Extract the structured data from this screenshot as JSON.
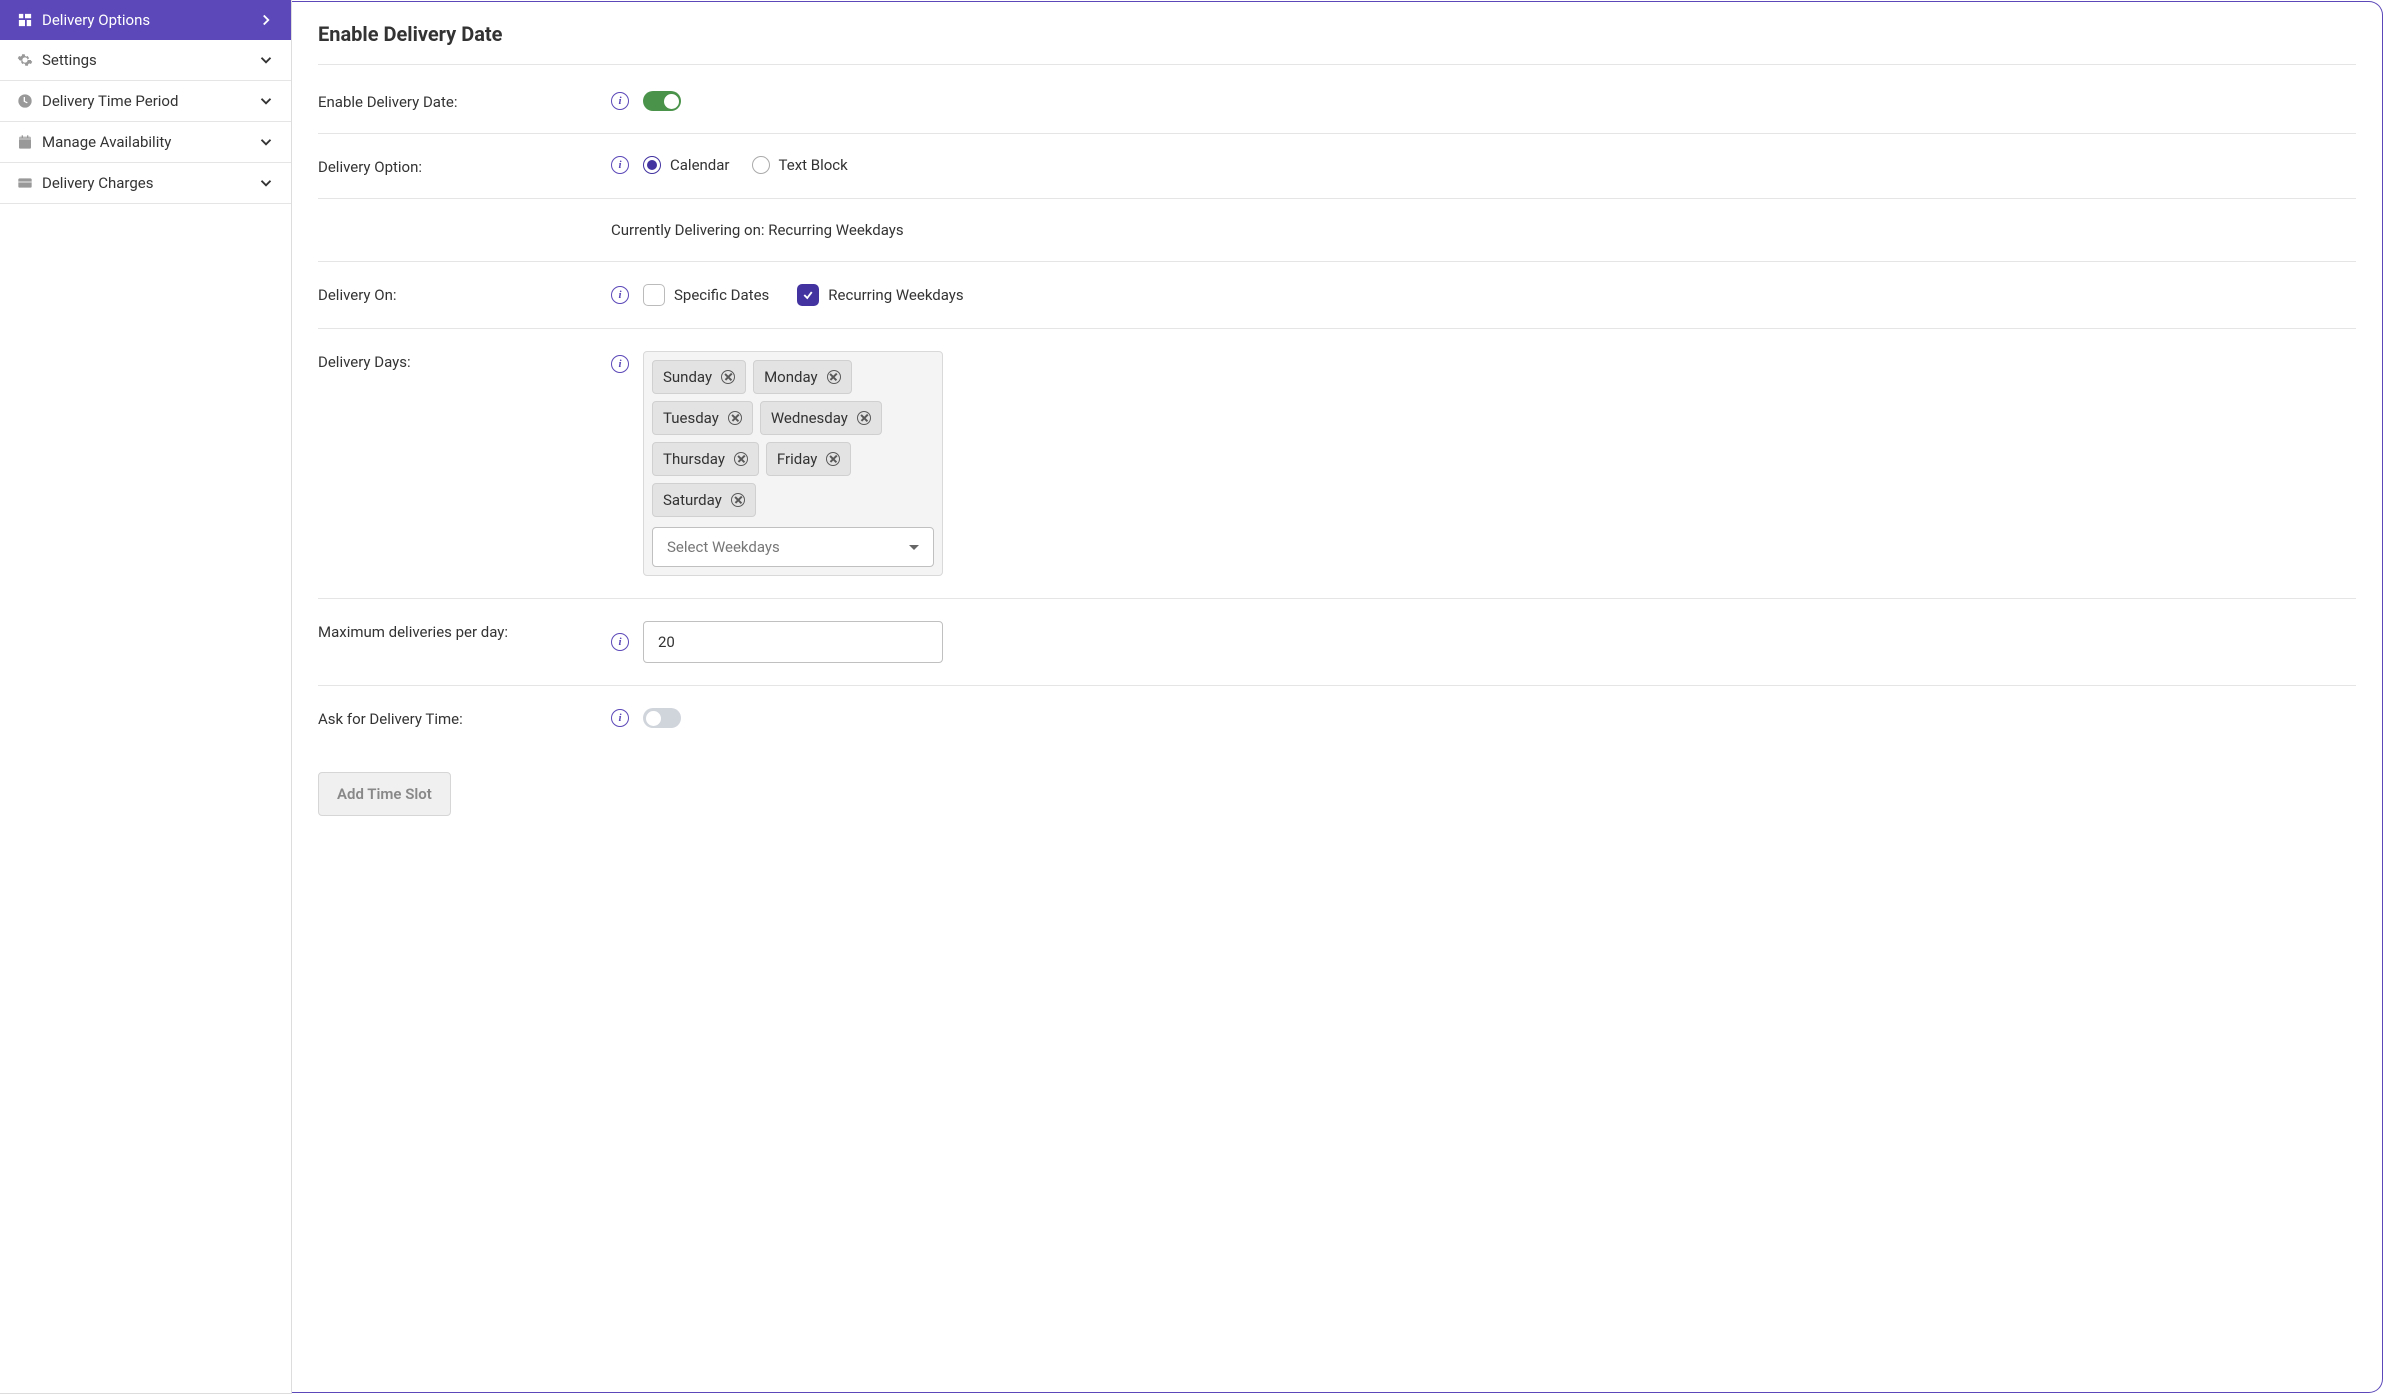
{
  "sidebar": {
    "items": [
      {
        "label": "Delivery Options",
        "icon": "grid-icon",
        "active": true,
        "expanded": true
      },
      {
        "label": "Settings",
        "icon": "gear-icon",
        "active": false,
        "expanded": false
      },
      {
        "label": "Delivery Time Period",
        "icon": "clock-icon",
        "active": false,
        "expanded": false
      },
      {
        "label": "Manage Availability",
        "icon": "calendar-icon",
        "active": false,
        "expanded": false
      },
      {
        "label": "Delivery Charges",
        "icon": "card-icon",
        "active": false,
        "expanded": false
      }
    ]
  },
  "page": {
    "title": "Enable Delivery Date"
  },
  "form": {
    "enableDate": {
      "label": "Enable Delivery Date:",
      "value": true
    },
    "deliveryOption": {
      "label": "Delivery Option:",
      "options": [
        "Calendar",
        "Text Block"
      ],
      "selected": "Calendar"
    },
    "currentlyDelivering": {
      "text": "Currently Delivering on: Recurring Weekdays"
    },
    "deliveryOn": {
      "label": "Delivery On:",
      "options": [
        {
          "label": "Specific Dates",
          "checked": false
        },
        {
          "label": "Recurring Weekdays",
          "checked": true
        }
      ]
    },
    "deliveryDays": {
      "label": "Delivery Days:",
      "chips": [
        "Sunday",
        "Monday",
        "Tuesday",
        "Wednesday",
        "Thursday",
        "Friday",
        "Saturday"
      ],
      "selectPlaceholder": "Select Weekdays"
    },
    "maxDeliveries": {
      "label": "Maximum deliveries per day:",
      "value": "20"
    },
    "askDeliveryTime": {
      "label": "Ask for Delivery Time:",
      "value": false
    },
    "addTimeSlot": {
      "label": "Add Time Slot"
    }
  }
}
